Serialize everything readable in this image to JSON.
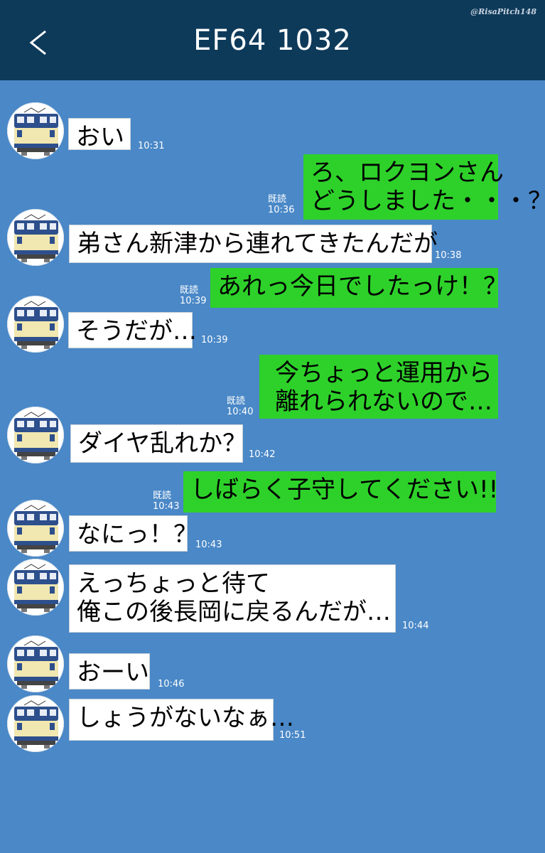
{
  "header": {
    "title": "EF64 1032",
    "back_icon": "chevron-left-icon",
    "watermark": "@RisaPitch148"
  },
  "colors": {
    "header_bg": "#0e3a5a",
    "chat_bg": "#4a88c7",
    "incoming_bubble": "#ffffff",
    "outgoing_bubble": "#2ed12a"
  },
  "messages": [
    {
      "dir": "in",
      "text": "おい",
      "time": "10:31"
    },
    {
      "dir": "out",
      "text": "ろ、ロクヨンさん\nどうしました・・・？",
      "read": "既読",
      "time": "10:36"
    },
    {
      "dir": "in",
      "text": "弟さん新津から連れてきたんだが",
      "time": "10:38"
    },
    {
      "dir": "out",
      "text": "あれっ今日でしたっけ！？",
      "read": "既読",
      "time": "10:39"
    },
    {
      "dir": "in",
      "text": "そうだが…",
      "time": "10:39"
    },
    {
      "dir": "out",
      "text": "今ちょっと運用から\n離れられないので…",
      "read": "既読",
      "time": "10:40"
    },
    {
      "dir": "in",
      "text": "ダイヤ乱れか？",
      "time": "10:42"
    },
    {
      "dir": "out",
      "text": "しばらく子守してください!!",
      "read": "既読",
      "time": "10:43"
    },
    {
      "dir": "in",
      "text": "なにっ！？",
      "time": "10:43"
    },
    {
      "dir": "in",
      "text": "えっちょっと待て\n俺この後長岡に戻るんだが…",
      "time": "10:44"
    },
    {
      "dir": "in",
      "text": "おーい",
      "time": "10:46"
    },
    {
      "dir": "in",
      "text": "しょうがないなぁ…",
      "time": "10:51"
    }
  ]
}
